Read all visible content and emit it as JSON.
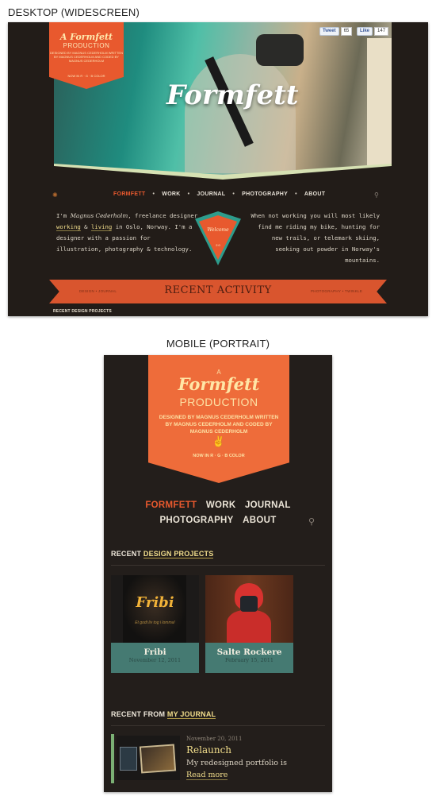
{
  "captions": {
    "desktop": "DESKTOP (WIDESCREEN)",
    "mobile": "MOBILE (PORTRAIT)"
  },
  "colors": {
    "accent": "#e8592e",
    "highlight": "#f2de8c",
    "teal": "#457a72",
    "background": "#231e1b"
  },
  "desktop": {
    "logo": "Formfett",
    "banner": {
      "line1": "A Formfett",
      "line2": "PRODUCTION",
      "credits": "DESIGNED BY MAGNUS CEDERHOLM WRITTEN BY MAGNUS CEDERHOLM AND CODED BY MAGNUS CEDERHOLM",
      "rgb": "NOW IN R · G · B COLOR"
    },
    "social": {
      "tweet_label": "Tweet",
      "tweet_count": "65",
      "like_label": "Like",
      "like_count": "147"
    },
    "nav": [
      {
        "label": "FORMFETT",
        "active": true
      },
      {
        "label": "WORK",
        "active": false
      },
      {
        "label": "JOURNAL",
        "active": false
      },
      {
        "label": "PHOTOGRAPHY",
        "active": false
      },
      {
        "label": "ABOUT",
        "active": false
      }
    ],
    "intro": {
      "pre": "I'm ",
      "name": "Magnus Cederholm",
      "mid1": ", freelance designer ",
      "working": "working",
      "amp": " & ",
      "living": "living",
      "post": " in Oslo, Norway. I'm a designer with a passion for illustration, photography & technology."
    },
    "right_text": "When not working you will most likely find me riding my bike, hunting for new trails, or telemark skiing, seeking out powder in Norway's mountains.",
    "badge": {
      "text": "Welcome",
      "version": "2.0"
    },
    "ribbon": {
      "title": "RECENT ACTIVITY",
      "left_tabs": "DESIGN  •  JOURNAL",
      "right_tabs": "PHOTOGRAPHY  •  TWINKLE"
    },
    "recent_label": "RECENT DESIGN PROJECTS"
  },
  "mobile": {
    "banner": {
      "a": "A",
      "logo": "Formfett",
      "production": "PRODUCTION",
      "credits": "DESIGNED BY MAGNUS CEDERHOLM WRITTEN BY MAGNUS CEDERHOLM AND CODED BY MAGNUS CEDERHOLM",
      "peace": "✌",
      "rgb": "NOW IN R · G · B COLOR"
    },
    "nav_row1": [
      {
        "label": "FORMFETT",
        "active": true
      },
      {
        "label": "WORK",
        "active": false
      },
      {
        "label": "JOURNAL",
        "active": false
      }
    ],
    "nav_row2": [
      {
        "label": "PHOTOGRAPHY",
        "active": false
      },
      {
        "label": "ABOUT",
        "active": false
      }
    ],
    "projects_heading": {
      "prefix": "RECENT ",
      "highlight": "DESIGN PROJECTS"
    },
    "projects": [
      {
        "title": "Fribi",
        "date": "November 12, 2011",
        "thumb_logo": "Fribi",
        "thumb_tagline": "Et godt liv tog i lomma!"
      },
      {
        "title": "Salte Rockere",
        "date": "February 15, 2011"
      }
    ],
    "journal_heading": {
      "prefix": "RECENT FROM ",
      "highlight": "MY JOURNAL"
    },
    "journal_entry": {
      "date": "November 20, 2011",
      "title": "Relaunch",
      "excerpt": "My redesigned portfolio is",
      "more": "Read more"
    }
  }
}
